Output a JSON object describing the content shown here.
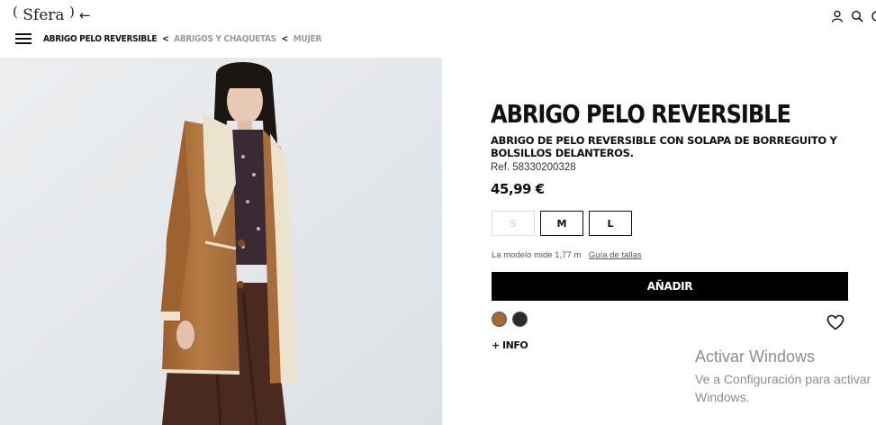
{
  "header": {
    "logo_paren_left": "(",
    "logo_text": "Sfera",
    "logo_paren_right": ")",
    "back_symbol": "←",
    "icons": [
      "user-icon",
      "search-icon",
      "cart-icon"
    ]
  },
  "breadcrumb": {
    "current": "ABRIGO PELO REVERSIBLE",
    "separator": "<",
    "items": [
      "ABRIGOS Y CHAQUETAS",
      "MUJER"
    ]
  },
  "product": {
    "image_alt": "Modelo con abrigo de pelo reversible color camel",
    "title": "ABRIGO PELO REVERSIBLE",
    "description": "ABRIGO DE PELO REVERSIBLE CON SOLAPA DE BORREGUITO Y BOLSILLOS DELANTEROS.",
    "ref": "Ref. 58330200328",
    "price": "45,99 €",
    "sizes": [
      {
        "label": "S",
        "available": false
      },
      {
        "label": "M",
        "available": true
      },
      {
        "label": "L",
        "available": true
      }
    ],
    "model_info": "La modelo mide 1,77 m",
    "size_guide": "Guía de tallas",
    "add_button": "AÑADIR",
    "colors": [
      "#a0693a",
      "#2b2b2b"
    ],
    "more_info": "+ INFO"
  },
  "watermark": {
    "line1": "Activar Windows",
    "line2": "Ve a Configuración para activar",
    "line3": "Windows."
  }
}
